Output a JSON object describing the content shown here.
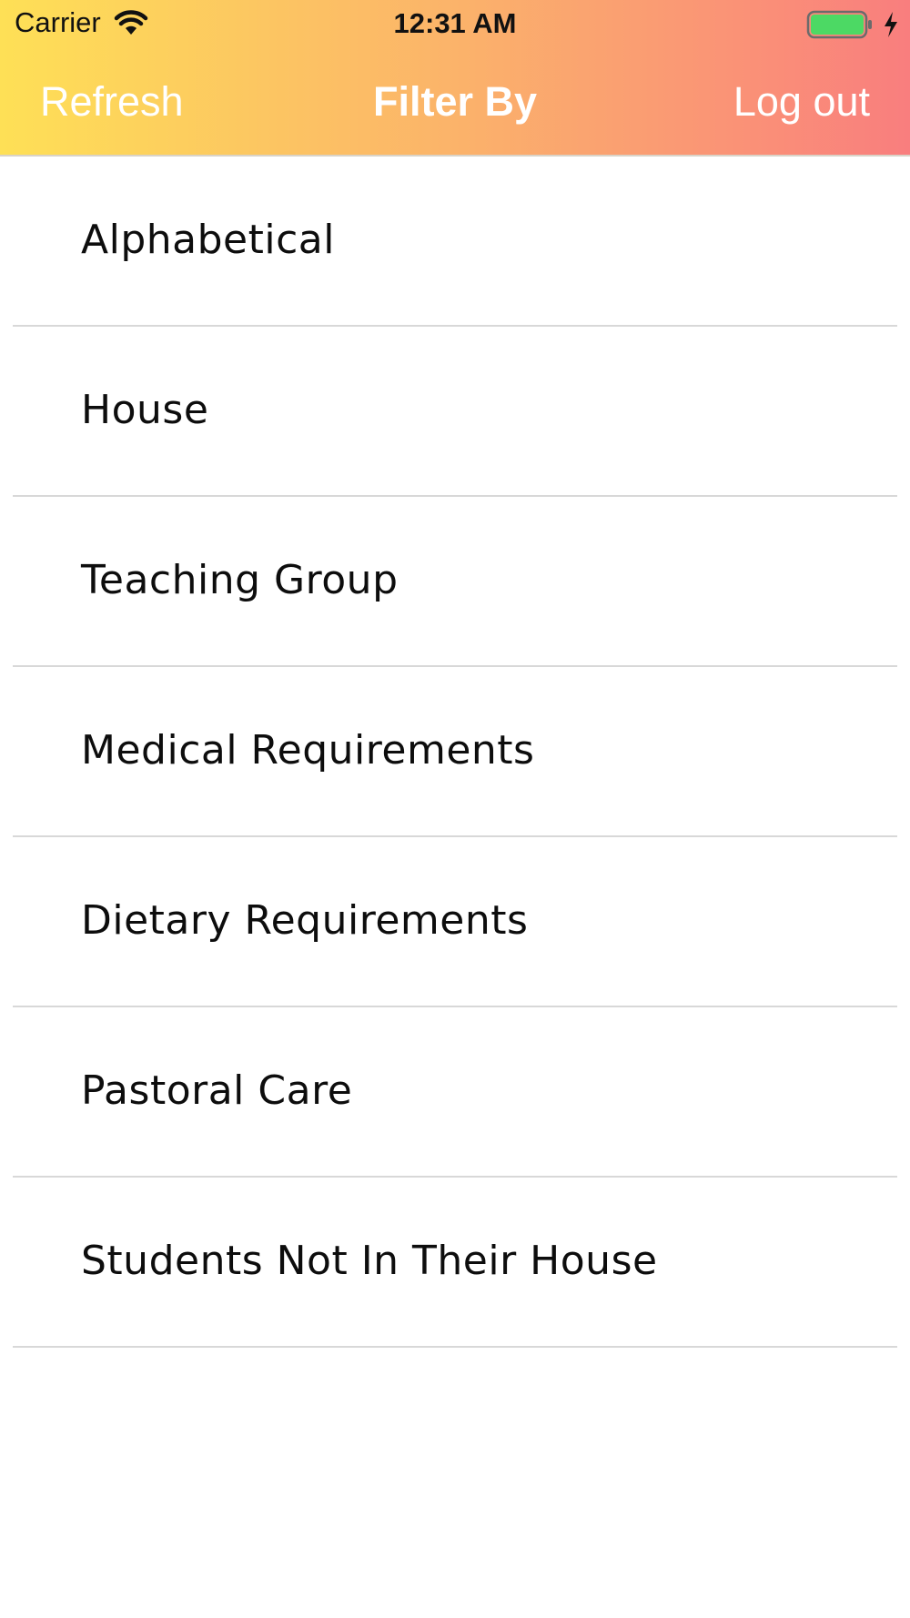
{
  "status_bar": {
    "carrier": "Carrier",
    "time": "12:31 AM",
    "wifi_icon": "wifi-icon",
    "battery_icon": "battery-icon",
    "charging_icon": "bolt-icon"
  },
  "nav": {
    "left_label": "Refresh",
    "title": "Filter By",
    "right_label": "Log out"
  },
  "filters": [
    {
      "label": "Alphabetical"
    },
    {
      "label": "House"
    },
    {
      "label": "Teaching Group"
    },
    {
      "label": "Medical Requirements"
    },
    {
      "label": "Dietary Requirements"
    },
    {
      "label": "Pastoral Care"
    },
    {
      "label": "Students Not In Their House"
    }
  ],
  "colors": {
    "header_gradient_start": "#fee056",
    "header_gradient_mid": "#fbb36a",
    "header_gradient_end": "#f97e7e",
    "nav_text": "#ffffff",
    "battery_fill": "#4cd964",
    "separator": "#d8d8d8"
  }
}
